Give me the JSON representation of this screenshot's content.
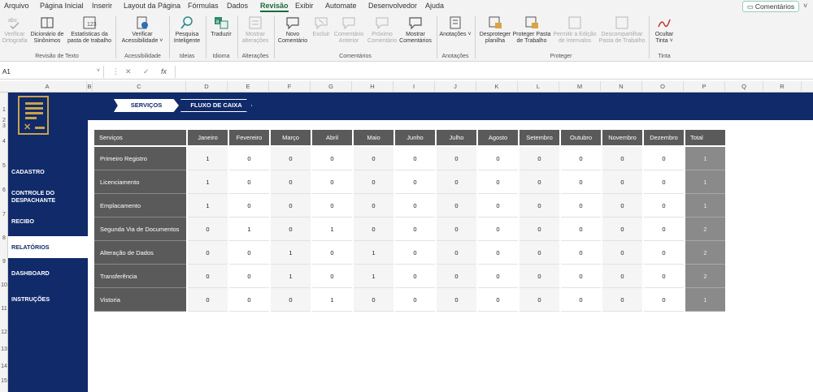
{
  "menu": {
    "items": [
      "Arquivo",
      "Página Inicial",
      "Inserir",
      "Layout da Página",
      "Fórmulas",
      "Dados",
      "Revisão",
      "Exibir",
      "Automate",
      "Desenvolvedor",
      "Ajuda"
    ],
    "active": "Revisão",
    "comments_button": "Comentários"
  },
  "ribbon": {
    "buttons": {
      "verificar_ortografia": "Verificar Ortografia",
      "dicionario_sinonimos": "Dicionário de Sinônimos",
      "estatisticas": "Estatísticas da pasta de trabalho",
      "verificar_acessibilidade": "Verificar Acessibilidade ˅",
      "pesquisa_inteligente": "Pesquisa Inteligente",
      "traduzir": "Traduzir",
      "mostrar_alteracoes": "Mostrar alterações",
      "novo_comentario": "Novo Comentário",
      "excluir": "Excluir",
      "comentario_anterior": "Comentário Anterior",
      "proximo_comentario": "Próximo Comentário",
      "mostrar_comentarios": "Mostrar Comentários",
      "anotacoes": "Anotações ˅",
      "desproteger_planilha": "Desproteger planilha",
      "proteger_pasta": "Proteger Pasta de Trabalho",
      "permitir_edicao": "Permitir a Edição de Intervalos",
      "descompartilhar": "Descompartilhar Pasta de Trabalho",
      "ocultar_tinta": "Ocultar Tinta ˅"
    },
    "groups": {
      "revisao_texto": "Revisão de Texto",
      "acessibilidade": "Acessibilidade",
      "ideias": "Ideias",
      "idioma": "Idioma",
      "alteracoes": "Alterações",
      "comentarios": "Comentários",
      "anotacoes": "Anotações",
      "proteger": "Proteger",
      "tinta": "Tinta"
    }
  },
  "formula_bar": {
    "name_box": "A1",
    "fx": "fx",
    "value": ""
  },
  "grid": {
    "columns": [
      "A",
      "B",
      "C",
      "D",
      "E",
      "F",
      "G",
      "H",
      "I",
      "J",
      "K",
      "L",
      "M",
      "N",
      "O",
      "P",
      "Q",
      "R"
    ],
    "rows": [
      "1",
      "2",
      "3",
      "4",
      "5",
      "6",
      "7",
      "8",
      "9",
      "10",
      "11",
      "12",
      "13",
      "14",
      "15"
    ]
  },
  "tabs": {
    "servicos": "SERVIÇOS",
    "fluxo_caixa": "FLUXO DE CAIXA"
  },
  "sidebar": {
    "items": [
      {
        "label": "CADASTRO"
      },
      {
        "label": "CONTROLE DO DESPACHANTE"
      },
      {
        "label": "RECIBO"
      },
      {
        "label": "RELATÓRIOS"
      },
      {
        "label": "DASHBOARD"
      },
      {
        "label": "INSTRUÇÕES"
      }
    ],
    "active": "RELATÓRIOS"
  },
  "report": {
    "headers": [
      "Serviços",
      "Janeiro",
      "Fevereiro",
      "Março",
      "Abril",
      "Maio",
      "Junho",
      "Julho",
      "Agosto",
      "Setembro",
      "Outubro",
      "Novembro",
      "Dezembro",
      "Total"
    ],
    "rows": [
      {
        "servico": "Primeiro Registro",
        "values": [
          1,
          0,
          0,
          0,
          0,
          0,
          0,
          0,
          0,
          0,
          0,
          0
        ],
        "total": 1
      },
      {
        "servico": "Licenciamento",
        "values": [
          1,
          0,
          0,
          0,
          0,
          0,
          0,
          0,
          0,
          0,
          0,
          0
        ],
        "total": 1
      },
      {
        "servico": "Emplacamento",
        "values": [
          1,
          0,
          0,
          0,
          0,
          0,
          0,
          0,
          0,
          0,
          0,
          0
        ],
        "total": 1
      },
      {
        "servico": "Segunda Via de Documentos",
        "values": [
          0,
          1,
          0,
          1,
          0,
          0,
          0,
          0,
          0,
          0,
          0,
          0
        ],
        "total": 2
      },
      {
        "servico": "Alteração de Dados",
        "values": [
          0,
          0,
          1,
          0,
          1,
          0,
          0,
          0,
          0,
          0,
          0,
          0
        ],
        "total": 2
      },
      {
        "servico": "Transferência",
        "values": [
          0,
          0,
          1,
          0,
          1,
          0,
          0,
          0,
          0,
          0,
          0,
          0
        ],
        "total": 2
      },
      {
        "servico": "Vistoria",
        "values": [
          0,
          0,
          0,
          1,
          0,
          0,
          0,
          0,
          0,
          0,
          0,
          0
        ],
        "total": 1
      }
    ]
  },
  "colors": {
    "navy": "#102a6a",
    "gold": "#c8a24a",
    "header_gray": "#5a5a5a",
    "total_gray": "#8a8a8a",
    "excel_green": "#1b6b3a"
  }
}
